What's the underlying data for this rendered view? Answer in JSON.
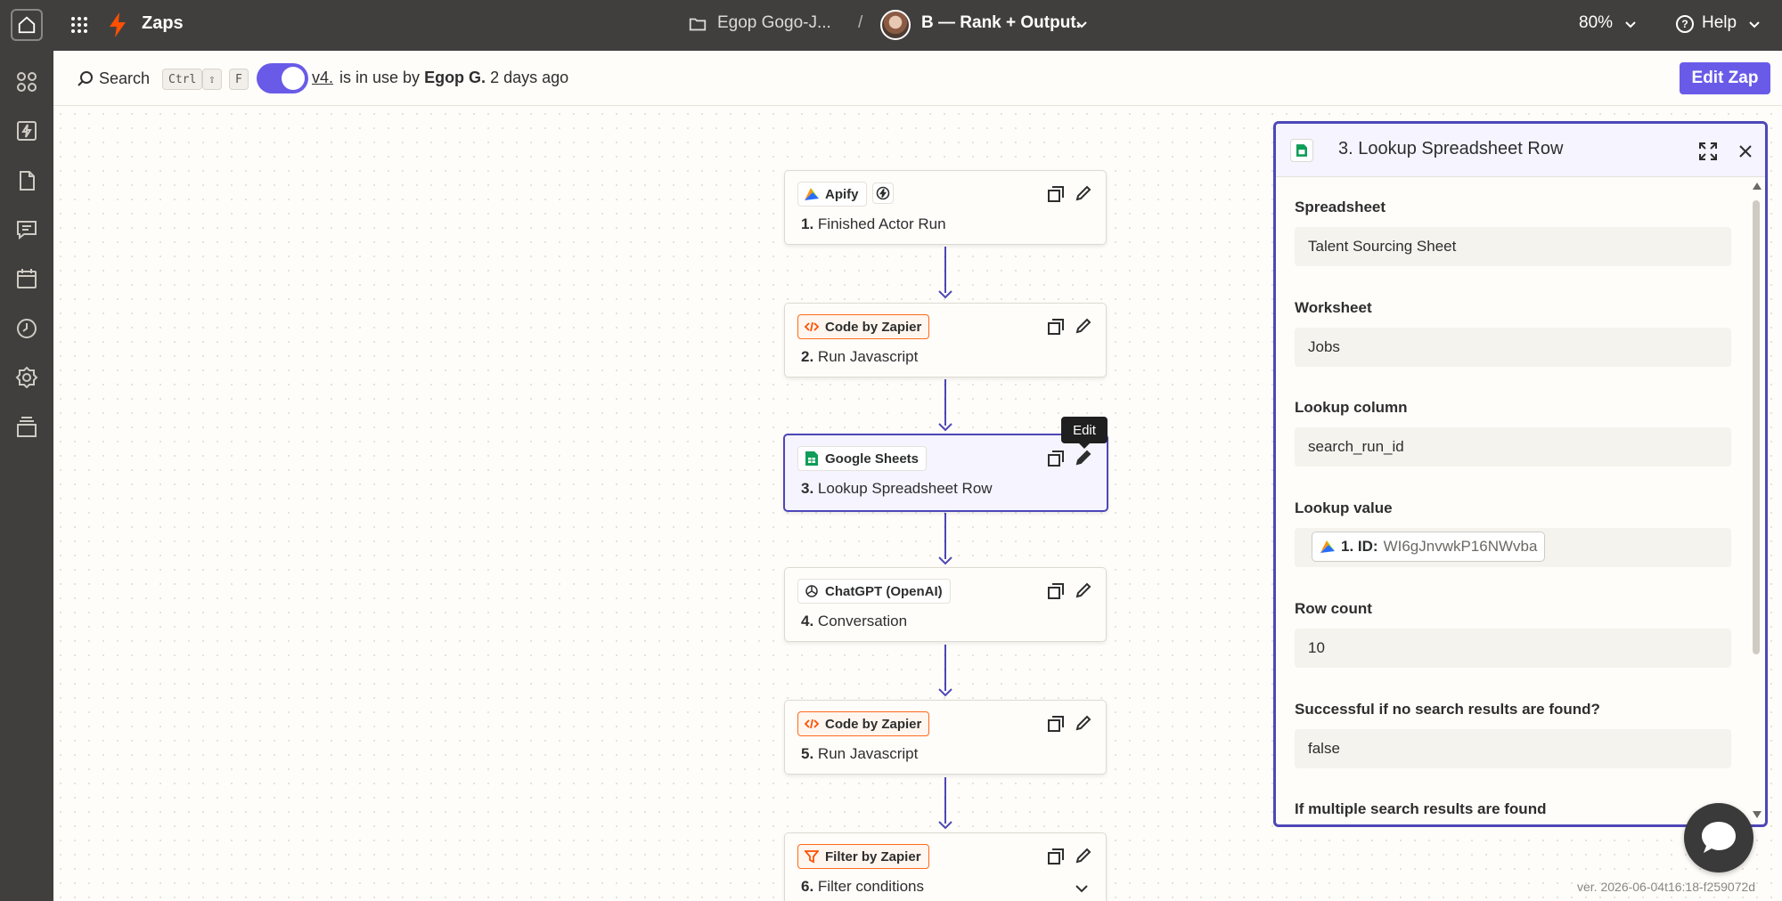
{
  "topbar": {
    "app_title": "Zaps",
    "folder_name": "Egop Gogo-J...",
    "separator": "/",
    "zap_name": "B — Rank + Output.",
    "zoom": "80%",
    "help": "Help"
  },
  "subbar": {
    "search_label": "Search",
    "shortcut_keys": [
      "Ctrl",
      "⇧",
      "F"
    ],
    "version_link": "v4.",
    "usage_prefix": "is in use by",
    "usage_user": "Egop G.",
    "usage_suffix": "2 days ago",
    "edit_zap_label": "Edit Zap"
  },
  "steps": [
    {
      "app": "Apify",
      "number": "1.",
      "title": "Finished Actor Run"
    },
    {
      "app": "Code by Zapier",
      "number": "2.",
      "title": "Run Javascript"
    },
    {
      "app": "Google Sheets",
      "number": "3.",
      "title": "Lookup Spreadsheet Row"
    },
    {
      "app": "ChatGPT (OpenAI)",
      "number": "4.",
      "title": "Conversation"
    },
    {
      "app": "Code by Zapier",
      "number": "5.",
      "title": "Run Javascript"
    },
    {
      "app": "Filter by Zapier",
      "number": "6.",
      "title": "Filter conditions"
    }
  ],
  "tooltip": "Edit",
  "panel": {
    "title": "3. Lookup Spreadsheet Row",
    "fields": [
      {
        "label": "Spreadsheet",
        "value": "Talent Sourcing Sheet"
      },
      {
        "label": "Worksheet",
        "value": "Jobs"
      },
      {
        "label": "Lookup column",
        "value": "search_run_id"
      },
      {
        "label": "Lookup value",
        "pill_label": "1. ID:",
        "pill_value": "WI6gJnvwkP16NWvba"
      },
      {
        "label": "Row count",
        "value": "10"
      },
      {
        "label": "Successful if no search results are found?",
        "value": "false"
      },
      {
        "label": "If multiple search results are found"
      }
    ]
  },
  "version_stamp": "ver. 2026-06-04t16:18-f259072d",
  "colors": {
    "accent": "#695be8",
    "selected_border": "#4d47b8",
    "topbar_bg": "#403f3e",
    "zapier_orange": "#ff4f00"
  }
}
